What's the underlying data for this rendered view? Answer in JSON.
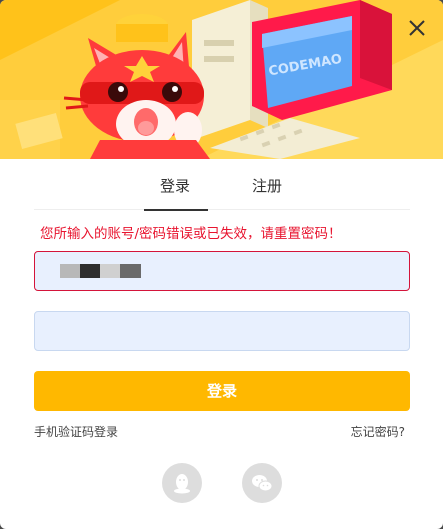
{
  "banner": {
    "monitor_text": "CODEMAO",
    "colors": {
      "background": "#ffc21a",
      "monitor": "#ff1a4a",
      "cat": "#ff2e2e"
    }
  },
  "close": {
    "icon": "close-icon"
  },
  "tabs": [
    {
      "label": "登录",
      "active": true
    },
    {
      "label": "注册",
      "active": false
    }
  ],
  "error": {
    "message": "您所输入的账号/密码错误或已失效，请重置密码！",
    "color": "#e8142f"
  },
  "form": {
    "account_value": "",
    "password_value": "",
    "login_button_label": "登录",
    "button_color": "#ffb800"
  },
  "links": {
    "sms_login": "手机验证码登录",
    "forgot_password": "忘记密码?"
  },
  "social": [
    {
      "name": "qq",
      "icon": "qq-icon"
    },
    {
      "name": "wechat",
      "icon": "wechat-icon"
    }
  ]
}
